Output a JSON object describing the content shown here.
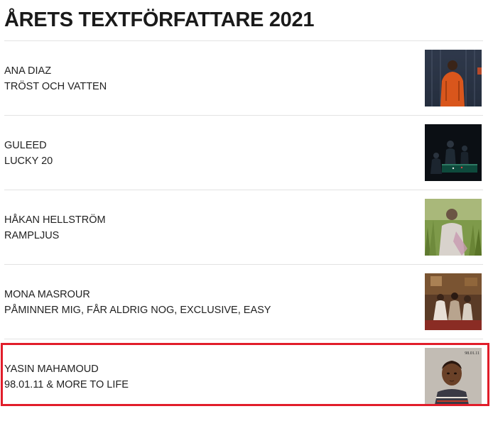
{
  "page": {
    "title": "ÅRETS TEXTFÖRFATTARE 2021",
    "highlight_color": "#e11d2a"
  },
  "nominees": [
    {
      "artist": "ANA DIAZ",
      "songs": "TRÖST OCH VATTEN",
      "cover_icon": "album-cover-orange-jacket"
    },
    {
      "artist": "GULEED",
      "songs": "LUCKY 20",
      "cover_icon": "album-cover-dark-pool-table"
    },
    {
      "artist": "HÅKAN HELLSTRÖM",
      "songs": "RAMPLJUS",
      "cover_icon": "album-cover-grass-portrait"
    },
    {
      "artist": "MONA MASROUR",
      "songs": "PÅMINNER MIG, FÅR ALDRIG NOG, EXCLUSIVE, EASY",
      "cover_icon": "album-cover-group-photo"
    },
    {
      "artist": "YASIN MAHAMOUD",
      "songs": "98.01.11 & MORE TO LIFE",
      "cover_icon": "album-cover-child-portrait",
      "cover_text": "98.01.11",
      "highlighted": true
    }
  ]
}
